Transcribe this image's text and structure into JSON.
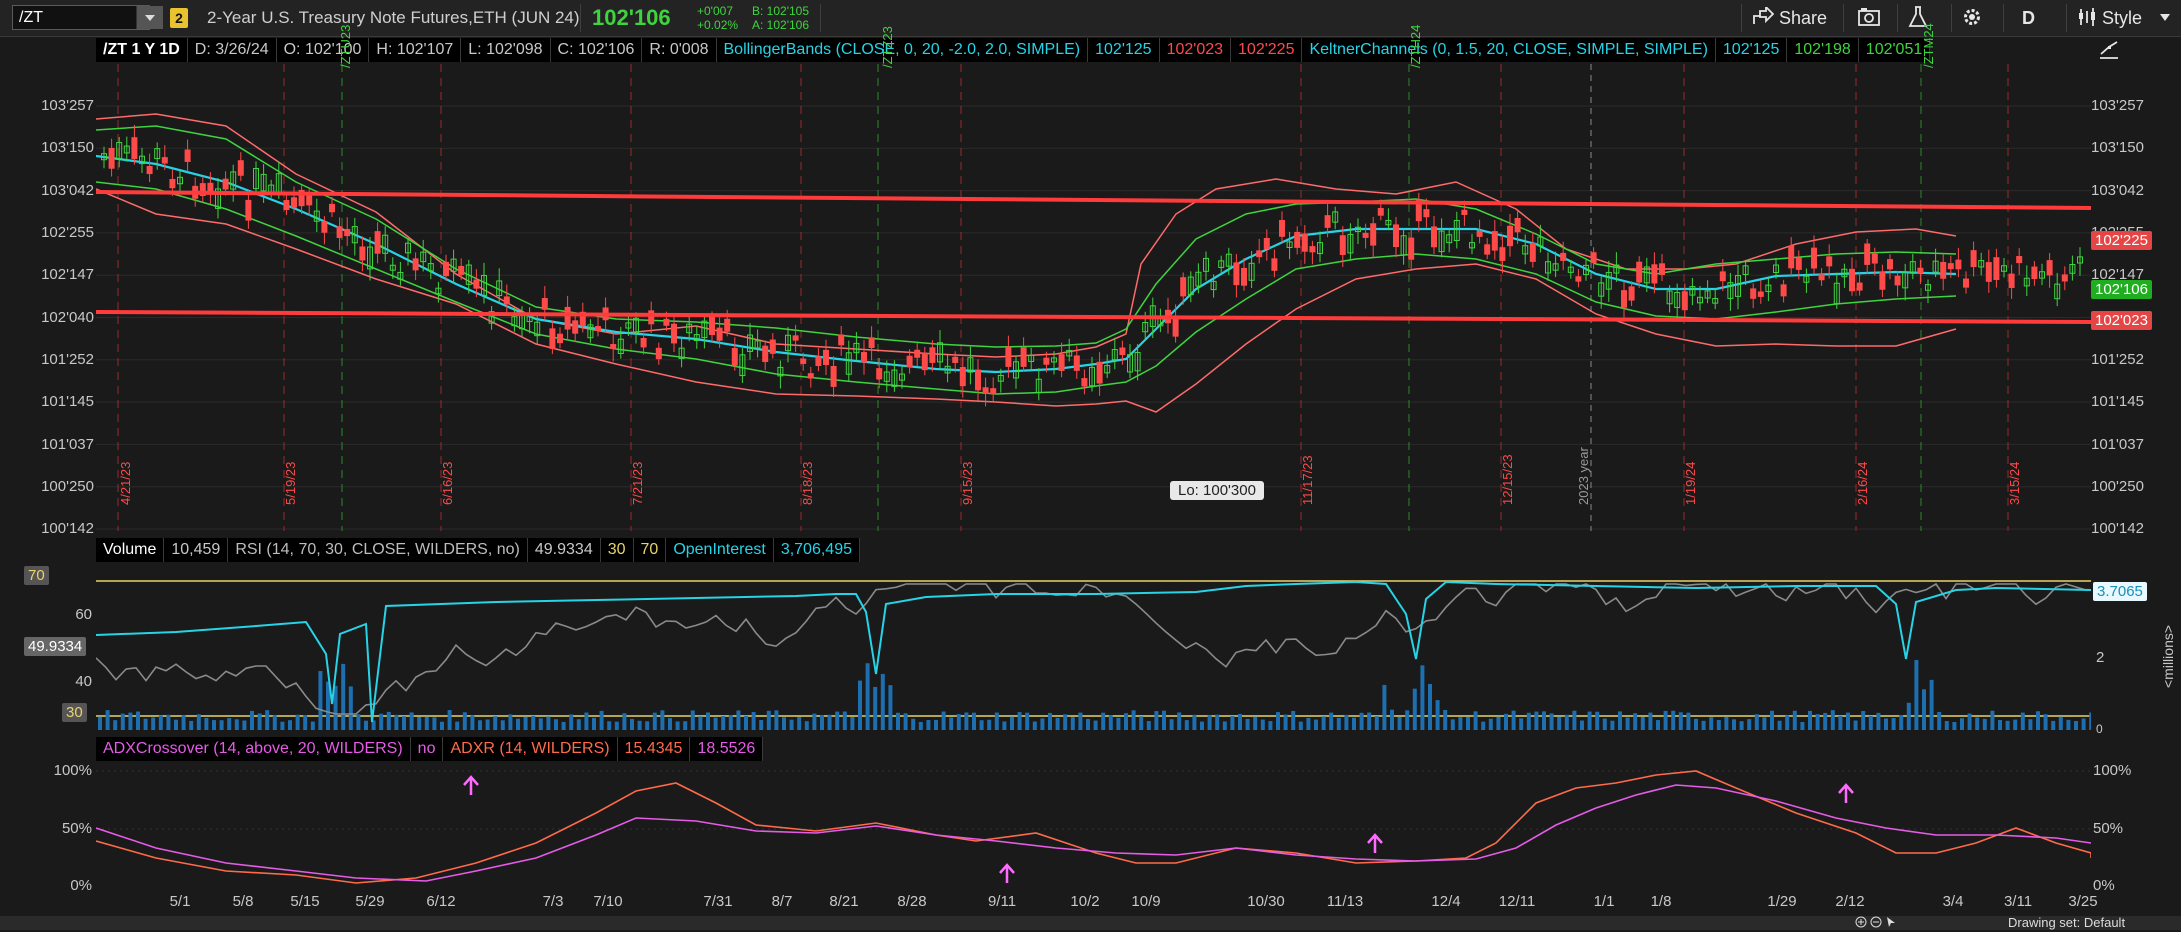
{
  "header": {
    "symbol_value": "/ZT",
    "link_number": "2",
    "description": "2-Year U.S. Treasury Note Futures,ETH (JUN 24)",
    "last_price": "102'106",
    "net_change": "+0'007",
    "pct_change": "+0.02%",
    "bid": "B: 102'105",
    "ask": "A: 102'106",
    "share_label": "Share",
    "period_label": "D",
    "style_label": "Style"
  },
  "studies_bar": {
    "symbol_period": "/ZT 1 Y 1D",
    "date": "D: 3/26/24",
    "open": "O: 102'100",
    "high": "H: 102'107",
    "low": "L: 102'098",
    "close": "C: 102'106",
    "range": "R: 0'008",
    "bb_label": "BollingerBands (CLOSE, 0, 20, -2.0, 2.0, SIMPLE)",
    "bb_mid": "102'125",
    "bb_low": "102'023",
    "bb_up": "102'225",
    "kc_label": "KeltnerChannels (0, 1.5, 20, CLOSE, SIMPLE, SIMPLE)",
    "kc_mid": "102'125",
    "kc_up": "102'198",
    "kc_low": "102'051"
  },
  "price_axis": {
    "ticks": [
      "103'257",
      "103'150",
      "103'042",
      "102'255",
      "102'147",
      "102'040",
      "101'252",
      "101'145",
      "101'037",
      "100'250",
      "100'142"
    ],
    "tag_bb_up": "102'225",
    "tag_last": "102'106",
    "tag_bb_low": "102'023",
    "low_callout": "Lo: 100'300"
  },
  "contract_labels": [
    "/ZTU23",
    "/ZTZ23",
    "/ZTH24",
    "/ZTM24"
  ],
  "date_markers": [
    "4/21/23",
    "5/19/23",
    "6/16/23",
    "7/21/23",
    "8/18/23",
    "9/15/23",
    "11/17/23",
    "12/15/23",
    "1/19/24",
    "2/16/24",
    "3/15/24"
  ],
  "year_marker": "2023 year",
  "volume_bar": {
    "volume_label": "Volume",
    "volume_value": "10,459",
    "rsi_label": "RSI (14, 70, 30, CLOSE, WILDERS, no)",
    "rsi_value": "49.9334",
    "rsi_ob_low": "30",
    "rsi_ob_high": "70",
    "oi_label": "OpenInterest",
    "oi_value": "3,706,495"
  },
  "volume_pane": {
    "left_ticks": [
      "70",
      "60",
      "49.9334",
      "40",
      "30"
    ],
    "right_tag": "3.7065",
    "right_ticks": [
      "2",
      "0"
    ],
    "unit_label": "<millions>"
  },
  "adx_bar": {
    "adx_label": "ADXCrossover (14, above, 20, WILDERS)",
    "adx_flag": "no",
    "adxr_label": "ADXR (14, WILDERS)",
    "adxr_value": "15.4345",
    "adx_value": "18.5526"
  },
  "adx_pane": {
    "ticks": [
      "100%",
      "50%",
      "0%"
    ]
  },
  "x_axis": [
    "5/1",
    "5/8",
    "5/15",
    "5/29",
    "6/12",
    "7/3",
    "7/10",
    "7/31",
    "8/7",
    "8/21",
    "8/28",
    "9/11",
    "10/2",
    "10/9",
    "10/30",
    "11/13",
    "12/4",
    "12/11",
    "1/1",
    "1/8",
    "1/29",
    "2/12",
    "3/4",
    "3/11",
    "3/25"
  ],
  "footer": {
    "drawing_set": "Drawing set: Default"
  },
  "colors": {
    "up": "#3fd43f",
    "down": "#ff4a4a",
    "cyan": "#27d3e6",
    "trendline": "#ff3b3b",
    "magenta": "#e55ce6",
    "adxr": "#ff6b4a"
  }
}
